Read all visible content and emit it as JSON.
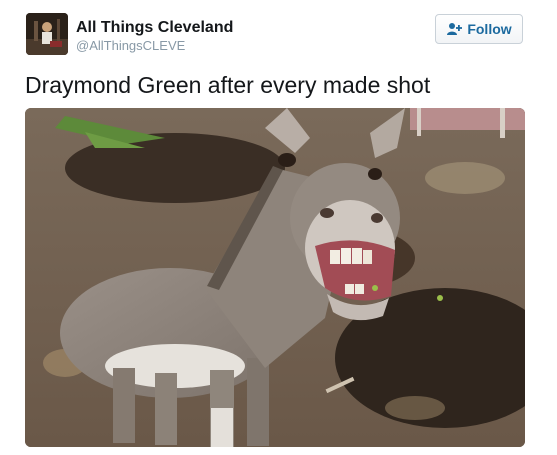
{
  "tweet": {
    "author": {
      "display_name": "All Things Cleveland",
      "handle": "@AllThingsCLEVE",
      "avatar_icon": "avatar-photo-icon"
    },
    "follow_button": {
      "label": "Follow",
      "icon": "add-user-icon"
    },
    "text": "Draymond Green after every made shot",
    "media": {
      "icon": "photo-donkey-icon"
    }
  },
  "colors": {
    "name": "#14171a",
    "handle": "#8899a6",
    "follow_text": "#1c6a9f",
    "follow_border": "#c9d1d8"
  }
}
